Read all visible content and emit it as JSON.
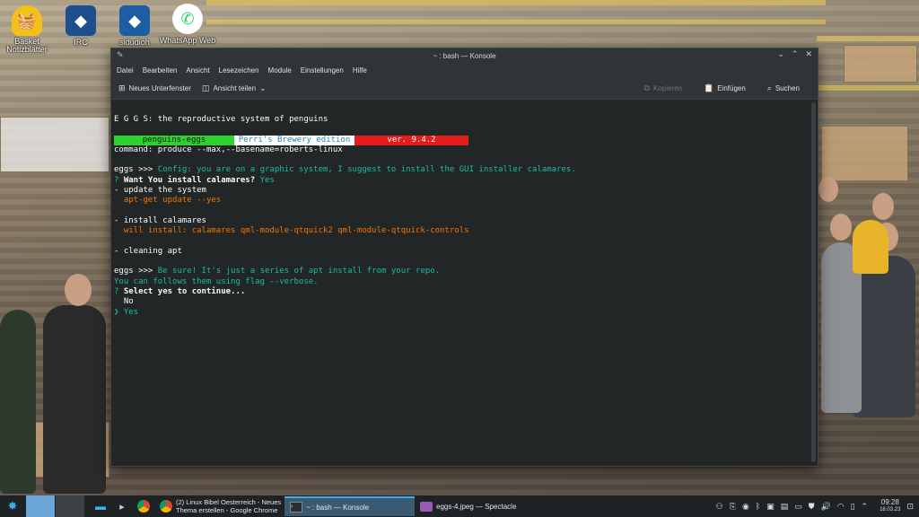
{
  "desktop": {
    "icons": [
      {
        "label": "Basket\nNotizblätter",
        "icon": "basket-icon",
        "color": "#f2c21a"
      },
      {
        "label": "IRC",
        "icon": "irc-icon",
        "color": "#1d4f8f"
      },
      {
        "label": "sidudioh",
        "icon": "app-icon",
        "color": "#1c5da3"
      },
      {
        "label": "WhatsApp Web",
        "icon": "whatsapp-icon",
        "color": "#25d366"
      }
    ]
  },
  "window": {
    "title": "~ : bash — Konsole",
    "menu": [
      "Datei",
      "Bearbeiten",
      "Ansicht",
      "Lesezeichen",
      "Module",
      "Einstellungen",
      "Hilfe"
    ],
    "toolbar": {
      "new_tab": "Neues Unterfenster",
      "split_view": "Ansicht teilen",
      "copy": "Kopieren",
      "paste": "Einfügen",
      "find": "Suchen"
    }
  },
  "terminal": {
    "line_title": "E G G S: the reproductive system of penguins",
    "bar": {
      "name": "penguins-eggs",
      "edition": "Perri's Brewery edition",
      "version": "ver. 9.4.2"
    },
    "line_command": "command: produce --max,--basename=roberts-linux",
    "eggs_prompt": "eggs >>> ",
    "config_msg": "Config: you are on a graphic system, I suggest to install the GUI installer calamares.",
    "q1_mark": "? ",
    "q1_text": "Want You install calamares?",
    "q1_answer": " Yes",
    "step1": "- update the system",
    "step1_cmd": "  apt-get update --yes",
    "step2": "- install calamares",
    "step2_cmd": "  will install: calamares qml-module-qtquick2 qml-module-qtquick-controls",
    "step3": "- cleaning apt",
    "sure_msg": "Be sure! It's just a series of apt install from your repo.",
    "verbose_msg": "You can follows them using flag --verbose.",
    "q2_text": "Select yes to continue...",
    "opt_no": "  No",
    "opt_yes_mark": "❯ ",
    "opt_yes": "Yes"
  },
  "taskbar": {
    "tasks": [
      {
        "label": "(2) Linux Bibel Oesterreich - Neues\nThema erstellen - Google Chrome",
        "icon": "chrome-icon"
      },
      {
        "label": "~ : bash — Konsole",
        "icon": "terminal-icon",
        "active": true
      },
      {
        "label": "eggs-4.jpeg — Spectacle",
        "icon": "spectacle-icon"
      }
    ],
    "clock_time": "09:28",
    "clock_date": "18.03.23"
  }
}
